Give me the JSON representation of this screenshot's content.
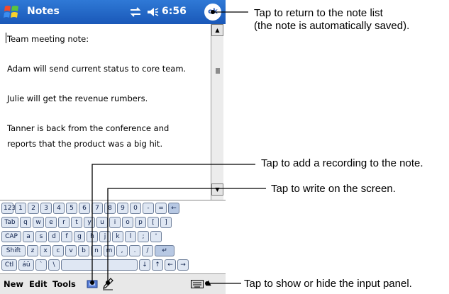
{
  "titlebar": {
    "app_title": "Notes",
    "time": "6:56",
    "ok_label": "ok"
  },
  "note": {
    "lines": [
      "Team meeting note:",
      "Adam will send current status to core team.",
      "Julie will get the revenue rumbers.",
      "Tanner is back from the conference and",
      "reports that the product was a big hit."
    ]
  },
  "keyboard": {
    "rows": [
      [
        "123",
        "1",
        "2",
        "3",
        "4",
        "5",
        "6",
        "7",
        "8",
        "9",
        "0",
        "-",
        "=",
        "←"
      ],
      [
        "Tab",
        "q",
        "w",
        "e",
        "r",
        "t",
        "y",
        "u",
        "i",
        "o",
        "p",
        "[",
        "]"
      ],
      [
        "CAP",
        "a",
        "s",
        "d",
        "f",
        "g",
        "h",
        "j",
        "k",
        "l",
        ";",
        "'"
      ],
      [
        "Shift",
        "z",
        "x",
        "c",
        "v",
        "b",
        "n",
        "m",
        ",",
        ".",
        "/",
        "↵"
      ],
      [
        "Ctl",
        "áü",
        "`",
        "\\",
        "",
        "↓",
        "↑",
        "←",
        "→"
      ]
    ]
  },
  "menubar": {
    "items": [
      "New",
      "Edit",
      "Tools"
    ]
  },
  "callouts": {
    "ok": "Tap to return to the note list\n(the note is automatically saved).",
    "record": "Tap to add a recording to the note.",
    "write": "Tap to write on the screen.",
    "input": "Tap to show or hide the input panel."
  },
  "colors": {
    "titlebar": "#1d5fc0",
    "key": "#dfe7f3",
    "menubar": "#e8e8e8"
  }
}
